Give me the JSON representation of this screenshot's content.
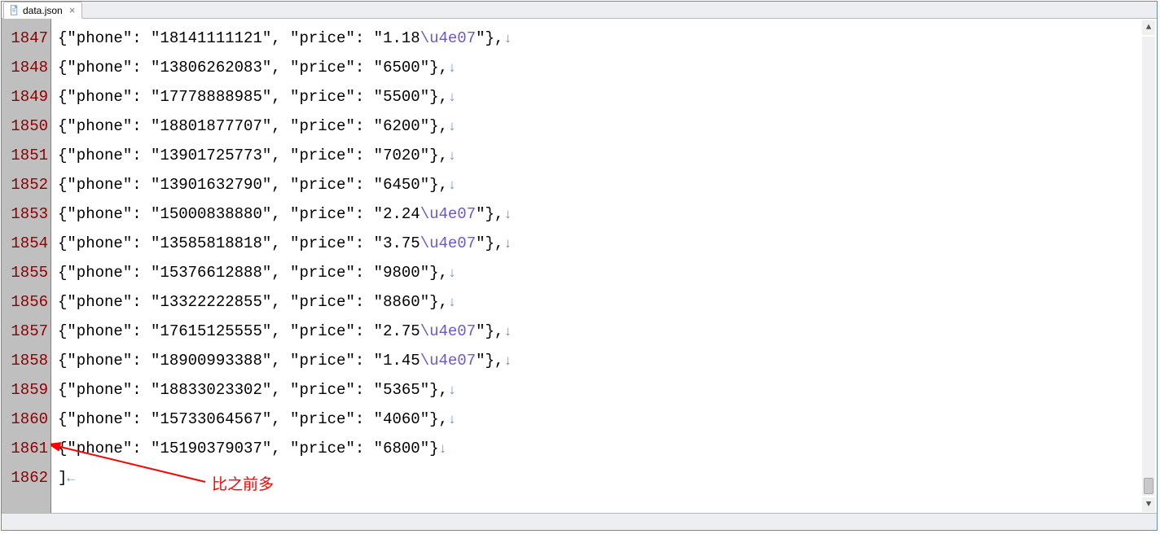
{
  "tab": {
    "filename": "data.json"
  },
  "newline_glyph": "↓",
  "eof_glyph": "←",
  "escape_token": "\\u4e07",
  "annotation": {
    "text": "比之前多"
  },
  "colors": {
    "line_number": "#8b0000",
    "escape": "#6a5acd",
    "newline_marker": "#6a8fd8",
    "annotation": "#ff0000",
    "gutter_bg": "#bfbfbf"
  },
  "lines": [
    {
      "n": 1847,
      "phone": "18141111121",
      "price_prefix": "1.18",
      "has_escape": true,
      "trailing_comma": true
    },
    {
      "n": 1848,
      "phone": "13806262083",
      "price_prefix": "6500",
      "has_escape": false,
      "trailing_comma": true
    },
    {
      "n": 1849,
      "phone": "17778888985",
      "price_prefix": "5500",
      "has_escape": false,
      "trailing_comma": true
    },
    {
      "n": 1850,
      "phone": "18801877707",
      "price_prefix": "6200",
      "has_escape": false,
      "trailing_comma": true
    },
    {
      "n": 1851,
      "phone": "13901725773",
      "price_prefix": "7020",
      "has_escape": false,
      "trailing_comma": true
    },
    {
      "n": 1852,
      "phone": "13901632790",
      "price_prefix": "6450",
      "has_escape": false,
      "trailing_comma": true
    },
    {
      "n": 1853,
      "phone": "15000838880",
      "price_prefix": "2.24",
      "has_escape": true,
      "trailing_comma": true
    },
    {
      "n": 1854,
      "phone": "13585818818",
      "price_prefix": "3.75",
      "has_escape": true,
      "trailing_comma": true
    },
    {
      "n": 1855,
      "phone": "15376612888",
      "price_prefix": "9800",
      "has_escape": false,
      "trailing_comma": true
    },
    {
      "n": 1856,
      "phone": "13322222855",
      "price_prefix": "8860",
      "has_escape": false,
      "trailing_comma": true
    },
    {
      "n": 1857,
      "phone": "17615125555",
      "price_prefix": "2.75",
      "has_escape": true,
      "trailing_comma": true
    },
    {
      "n": 1858,
      "phone": "18900993388",
      "price_prefix": "1.45",
      "has_escape": true,
      "trailing_comma": true
    },
    {
      "n": 1859,
      "phone": "18833023302",
      "price_prefix": "5365",
      "has_escape": false,
      "trailing_comma": true
    },
    {
      "n": 1860,
      "phone": "15733064567",
      "price_prefix": "4060",
      "has_escape": false,
      "trailing_comma": true
    },
    {
      "n": 1861,
      "phone": "15190379037",
      "price_prefix": "6800",
      "has_escape": false,
      "trailing_comma": false
    },
    {
      "n": 1862,
      "raw": "]",
      "eof": true
    }
  ]
}
